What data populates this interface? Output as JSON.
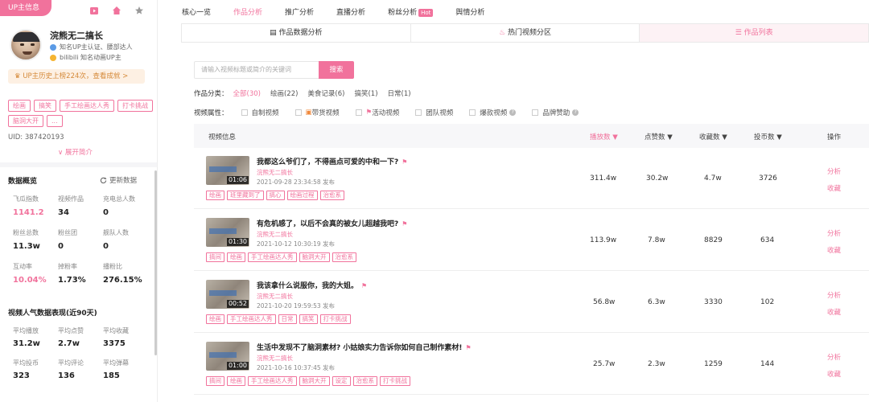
{
  "sidebar": {
    "tag": "UP主信息",
    "icons": [
      "video-icon",
      "home-icon",
      "star-icon"
    ],
    "name": "浣熊无二搞长",
    "cert": "知名UP主认证、腰部达人",
    "bili": "bilibili 知名动画UP主",
    "rank": "UP主历史上榜224次，查看成就 >",
    "tags": [
      "绘画",
      "搞笑",
      "手工绘画达人秀",
      "打卡挑战",
      "脑洞大开",
      "..."
    ],
    "uid": "UID: 387420193",
    "expand": "∨ 展开简介",
    "data_title": "数据概览",
    "refresh": "更新数据",
    "stats": [
      {
        "label": "飞瓜指数",
        "value": "1141.2",
        "pink": true
      },
      {
        "label": "视频作品",
        "value": "34"
      },
      {
        "label": "充电总人数",
        "value": "0"
      },
      {
        "label": "粉丝总数",
        "value": "11.3w"
      },
      {
        "label": "粉丝团",
        "value": "0"
      },
      {
        "label": "舰队人数",
        "value": "0"
      },
      {
        "label": "互动率",
        "value": "10.04%",
        "pink": true
      },
      {
        "label": "掉粉率",
        "value": "1.73%"
      },
      {
        "label": "播粉比",
        "value": "276.15%"
      }
    ],
    "perf_title": "视频人气数据表现(近90天)",
    "perf": [
      {
        "label": "平均播放",
        "value": "31.2w"
      },
      {
        "label": "平均点赞",
        "value": "2.7w"
      },
      {
        "label": "平均收藏",
        "value": "3375"
      },
      {
        "label": "平均投币",
        "value": "323"
      },
      {
        "label": "平均评论",
        "value": "136"
      },
      {
        "label": "平均弹幕",
        "value": "185"
      }
    ]
  },
  "nav": {
    "items": [
      "核心一览",
      "作品分析",
      "推广分析",
      "直播分析",
      "粉丝分析",
      "舆情分析"
    ],
    "hot": "Hot"
  },
  "subtabs": [
    "作品数据分析",
    "热门视频分区",
    "作品列表"
  ],
  "search": {
    "placeholder": "请输入视频标题或简介的关键词",
    "button": "搜索"
  },
  "filters": {
    "cat_label": "作品分类：",
    "cats": [
      "全部(30)",
      "绘画(22)",
      "美食记录(6)",
      "搞笑(1)",
      "日常(1)"
    ],
    "attr_label": "视频属性：",
    "attrs": [
      "自制视频",
      "带货视频",
      "活动视频",
      "团队视频",
      "爆款视频",
      "品牌赞助"
    ]
  },
  "table": {
    "headers": [
      "视频信息",
      "播放数 ▼",
      "点赞数 ▼",
      "收藏数 ▼",
      "投币数 ▼",
      "操作"
    ],
    "ops": [
      "分析",
      "收藏"
    ],
    "rows": [
      {
        "title": "我都这么爷们了，不得画点可爱的中和一下?",
        "author": "浣熊无二搞长",
        "date": "2021-09-28 23:34:58 发布",
        "dur": "01:06",
        "tags": [
          "绘画",
          "班里藏到了",
          "搞心",
          "绘画过程",
          "治愈系"
        ],
        "play": "311.4w",
        "like": "30.2w",
        "fav": "4.7w",
        "coin": "3726"
      },
      {
        "title": "有危机感了，以后不会真的被女儿超越我吧?",
        "author": "浣熊无二搞长",
        "date": "2021-10-12 10:30:19 发布",
        "dur": "01:30",
        "tags": [
          "搞间",
          "绘画",
          "手工绘画达人秀",
          "脑洞大开",
          "治愈系"
        ],
        "play": "113.9w",
        "like": "7.8w",
        "fav": "8829",
        "coin": "634"
      },
      {
        "title": "我该拿什么说服你，我的大姐。",
        "author": "浣熊无二搞长",
        "date": "2021-10-20 19:59:53 发布",
        "dur": "00:52",
        "tags": [
          "绘画",
          "手工绘画达人秀",
          "日常",
          "搞笑",
          "打卡挑战"
        ],
        "play": "56.8w",
        "like": "6.3w",
        "fav": "3330",
        "coin": "102"
      },
      {
        "title": "生活中发现不了脑洞素材? 小姑娘实力告诉你如何自己制作素材!",
        "author": "浣熊无二搞长",
        "date": "2021-10-16 10:37:45 发布",
        "dur": "01:00",
        "tags": [
          "搞间",
          "绘画",
          "手工绘画达人秀",
          "脑洞大开",
          "设定",
          "治愈系",
          "打卡挑战"
        ],
        "play": "25.7w",
        "like": "2.3w",
        "fav": "1259",
        "coin": "144"
      }
    ]
  }
}
